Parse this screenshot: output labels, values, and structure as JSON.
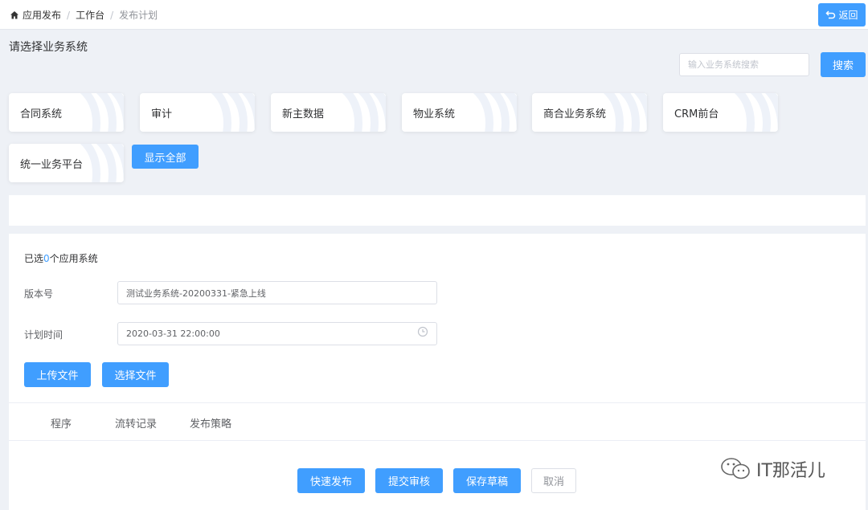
{
  "breadcrumb": {
    "items": [
      "应用发布",
      "工作台",
      "发布计划"
    ],
    "separator": "/"
  },
  "header": {
    "back_label": "返回"
  },
  "business_systems": {
    "title": "请选择业务系统",
    "search_placeholder": "输入业务系统搜索",
    "search_label": "搜索",
    "cards": [
      "合同系统",
      "审计",
      "新主数据",
      "物业系统",
      "商合业务系统",
      "CRM前台",
      "统一业务平台"
    ],
    "show_all_label": "显示全部"
  },
  "form": {
    "selected_prefix": "已选",
    "selected_count": "0",
    "selected_suffix": "个应用系统",
    "version_label": "版本号",
    "version_value": "测试业务系统-20200331-紧急上线",
    "time_label": "计划时间",
    "time_value": "2020-03-31 22:00:00",
    "upload_label": "上传文件",
    "choose_label": "选择文件"
  },
  "tabs": [
    "程序",
    "流转记录",
    "发布策略"
  ],
  "actions": {
    "quick_publish": "快速发布",
    "submit_review": "提交审核",
    "save_draft": "保存草稿",
    "cancel": "取消"
  },
  "watermark": {
    "text": "IT那活儿",
    "icon": "wechat-icon"
  },
  "colors": {
    "primary": "#409eff",
    "background": "#eef1f6"
  }
}
